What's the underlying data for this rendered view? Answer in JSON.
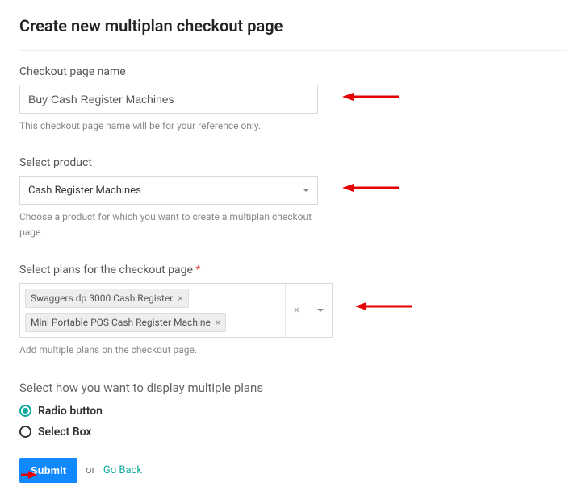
{
  "page": {
    "title": "Create new multiplan checkout page"
  },
  "checkoutName": {
    "label": "Checkout page name",
    "value": "Buy Cash Register Machines",
    "placeholder": "",
    "helper": "This checkout page name will be for your reference only."
  },
  "selectProduct": {
    "label": "Select product",
    "value": "Cash Register Machines",
    "helper": "Choose a product for which you want to create a multiplan checkout page."
  },
  "selectPlans": {
    "label": "Select plans for the checkout page",
    "required": "*",
    "chips": [
      {
        "label": "Swaggers dp 3000 Cash Register"
      },
      {
        "label": "Mini Portable POS Cash Register Machine"
      }
    ],
    "helper": "Add multiple plans on the checkout page."
  },
  "displayMode": {
    "label": "Select how you want to display multiple plans",
    "options": [
      {
        "label": "Radio button",
        "selected": true
      },
      {
        "label": "Select Box",
        "selected": false
      }
    ]
  },
  "actions": {
    "submit": "Submit",
    "or": "or",
    "goBack": "Go Back"
  }
}
